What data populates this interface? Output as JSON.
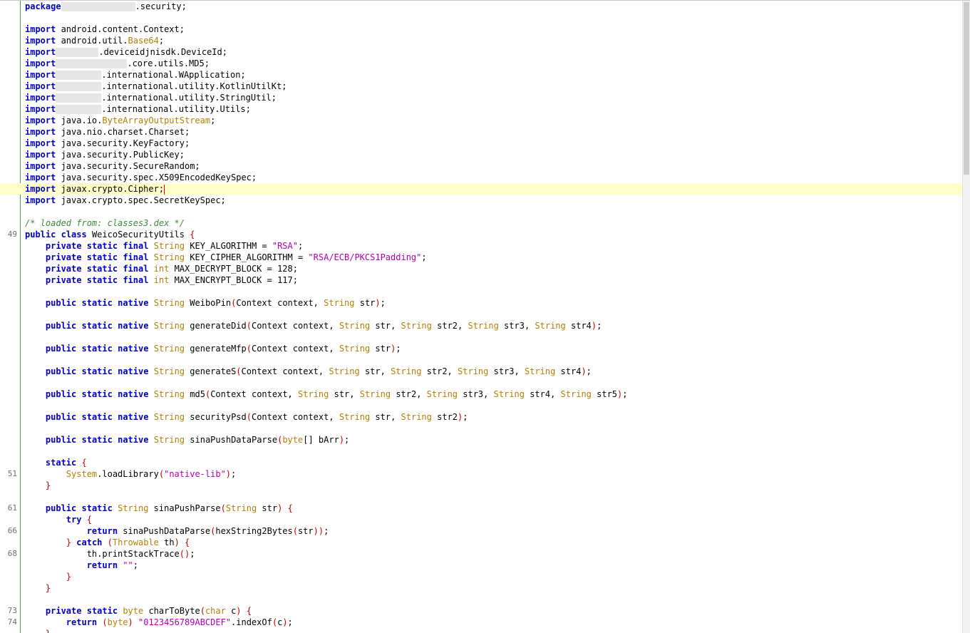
{
  "editor": {
    "highlighted_line": 16,
    "scrollbar_position": 0.0
  },
  "lines": [
    {
      "n": "",
      "t": "package",
      "redacted_width": 104,
      "after": ".security;"
    },
    {
      "n": "",
      "t": ""
    },
    {
      "n": "",
      "t": "import android.content.Context;"
    },
    {
      "n": "",
      "t": "import android.util.Base64;"
    },
    {
      "n": "",
      "t": "import",
      "redacted_width": 60,
      "after": ".deviceidjnisdk.DeviceId;"
    },
    {
      "n": "",
      "t": "import",
      "redacted_width": 100,
      "after": ".core.utils.MD5;"
    },
    {
      "n": "",
      "t": "import",
      "redacted_width": 64,
      "after": ".international.WApplication;"
    },
    {
      "n": "",
      "t": "import",
      "redacted_width": 64,
      "after": ".international.utility.KotlinUtilKt;"
    },
    {
      "n": "",
      "t": "import",
      "redacted_width": 64,
      "after": ".international.utility.StringUtil;"
    },
    {
      "n": "",
      "t": "import",
      "redacted_width": 64,
      "after": ".international.utility.Utils;"
    },
    {
      "n": "",
      "t": "import java.io.ByteArrayOutputStream;"
    },
    {
      "n": "",
      "t": "import java.nio.charset.Charset;"
    },
    {
      "n": "",
      "t": "import java.security.KeyFactory;"
    },
    {
      "n": "",
      "t": "import java.security.PublicKey;"
    },
    {
      "n": "",
      "t": "import java.security.SecureRandom;"
    },
    {
      "n": "",
      "t": "import java.security.spec.X509EncodedKeySpec;"
    },
    {
      "n": "",
      "t": "import javax.crypto.Cipher;"
    },
    {
      "n": "",
      "t": "import javax.crypto.spec.SecretKeySpec;"
    },
    {
      "n": "",
      "t": ""
    },
    {
      "n": "",
      "t": "/* loaded from: classes3.dex */"
    },
    {
      "n": "49",
      "t": "public class WeicoSecurityUtils {"
    },
    {
      "n": "",
      "t": "    private static final String KEY_ALGORITHM = \"RSA\";"
    },
    {
      "n": "",
      "t": "    private static final String KEY_CIPHER_ALGORITHM = \"RSA/ECB/PKCS1Padding\";"
    },
    {
      "n": "",
      "t": "    private static final int MAX_DECRYPT_BLOCK = 128;"
    },
    {
      "n": "",
      "t": "    private static final int MAX_ENCRYPT_BLOCK = 117;"
    },
    {
      "n": "",
      "t": ""
    },
    {
      "n": "",
      "t": "    public static native String WeiboPin(Context context, String str);"
    },
    {
      "n": "",
      "t": ""
    },
    {
      "n": "",
      "t": "    public static native String generateDid(Context context, String str, String str2, String str3, String str4);"
    },
    {
      "n": "",
      "t": ""
    },
    {
      "n": "",
      "t": "    public static native String generateMfp(Context context, String str);"
    },
    {
      "n": "",
      "t": ""
    },
    {
      "n": "",
      "t": "    public static native String generateS(Context context, String str, String str2, String str3, String str4);"
    },
    {
      "n": "",
      "t": ""
    },
    {
      "n": "",
      "t": "    public static native String md5(Context context, String str, String str2, String str3, String str4, String str5);"
    },
    {
      "n": "",
      "t": ""
    },
    {
      "n": "",
      "t": "    public static native String securityPsd(Context context, String str, String str2);"
    },
    {
      "n": "",
      "t": ""
    },
    {
      "n": "",
      "t": "    public static native String sinaPushDataParse(byte[] bArr);"
    },
    {
      "n": "",
      "t": ""
    },
    {
      "n": "",
      "t": "    static {"
    },
    {
      "n": "51",
      "t": "        System.loadLibrary(\"native-lib\");"
    },
    {
      "n": "",
      "t": "    }"
    },
    {
      "n": "",
      "t": ""
    },
    {
      "n": "61",
      "t": "    public static String sinaPushParse(String str) {"
    },
    {
      "n": "",
      "t": "        try {"
    },
    {
      "n": "66",
      "t": "            return sinaPushDataParse(hexString2Bytes(str));"
    },
    {
      "n": "",
      "t": "        } catch (Throwable th) {"
    },
    {
      "n": "68",
      "t": "            th.printStackTrace();"
    },
    {
      "n": "",
      "t": "            return \"\";"
    },
    {
      "n": "",
      "t": "        }"
    },
    {
      "n": "",
      "t": "    }"
    },
    {
      "n": "",
      "t": ""
    },
    {
      "n": "73",
      "t": "    private static byte charToByte(char c) {"
    },
    {
      "n": "74",
      "t": "        return (byte) \"0123456789ABCDEF\".indexOf(c);"
    },
    {
      "n": "",
      "t": "    }"
    }
  ]
}
